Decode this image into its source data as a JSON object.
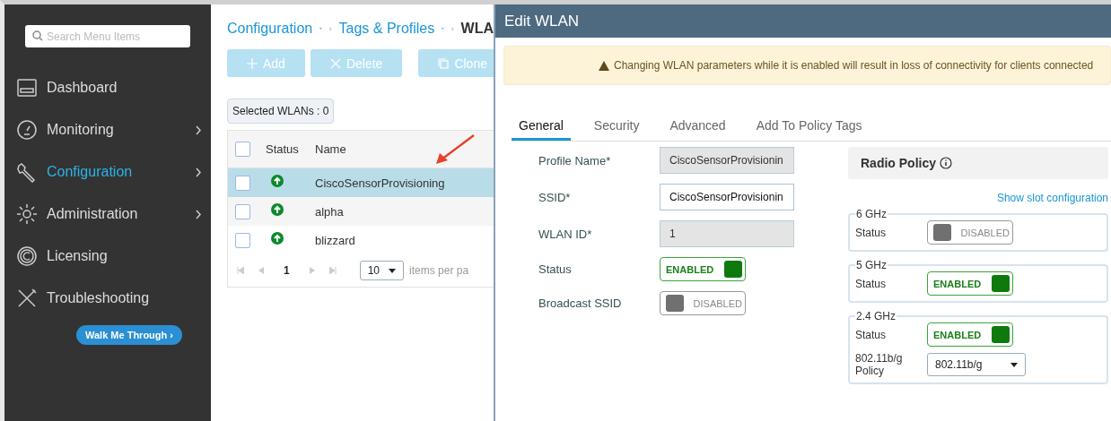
{
  "sidebar": {
    "search": {
      "placeholder": "Search Menu Items"
    },
    "items": [
      {
        "label": "Dashboard",
        "kind": "dashboard",
        "selected": false,
        "has_arrow": false
      },
      {
        "label": "Monitoring",
        "kind": "monitoring",
        "selected": false,
        "has_arrow": true
      },
      {
        "label": "Configuration",
        "kind": "configuration",
        "selected": true,
        "has_arrow": true
      },
      {
        "label": "Administration",
        "kind": "administration",
        "selected": false,
        "has_arrow": true
      },
      {
        "label": "Licensing",
        "kind": "licensing",
        "selected": false,
        "has_arrow": false
      },
      {
        "label": "Troubleshooting",
        "kind": "troubleshooting",
        "selected": false,
        "has_arrow": false
      }
    ],
    "walk_button": "Walk Me Through ›"
  },
  "breadcrumb": [
    {
      "label": "Configuration",
      "link": true
    },
    {
      "label": "Tags & Profiles",
      "link": true
    },
    {
      "label": "WLA",
      "link": false
    }
  ],
  "toolbar": [
    {
      "label": "Add",
      "kind": "add"
    },
    {
      "label": "Delete",
      "kind": "delete"
    },
    {
      "label": "Clone",
      "kind": "clone"
    }
  ],
  "selected_count": "Selected WLANs : 0",
  "table": {
    "columns": [
      "Status",
      "Name"
    ],
    "all_checked": false,
    "rows": [
      {
        "name": "CiscoSensorProvisioning",
        "selected": true,
        "checked": false
      },
      {
        "name": "alpha",
        "selected": false,
        "checked": false
      },
      {
        "name": "blizzard",
        "selected": false,
        "checked": false
      }
    ],
    "pagination": {
      "page": "1",
      "page_size": "10",
      "items_label": "items per pa"
    }
  },
  "edit_panel": {
    "title": "Edit WLAN",
    "warning": "Changing WLAN parameters while it is enabled will result in loss of connectivity for clients connected",
    "tabs": [
      {
        "label": "General",
        "selected": true
      },
      {
        "label": "Security",
        "selected": false
      },
      {
        "label": "Advanced",
        "selected": false
      },
      {
        "label": "Add To Policy Tags",
        "selected": false
      }
    ],
    "fields": [
      {
        "label": "Profile Name*",
        "kind": "text",
        "value": "CiscoSensorProvisionin",
        "disabled": true
      },
      {
        "label": "SSID*",
        "kind": "text",
        "value": "CiscoSensorProvisionin",
        "disabled": false
      },
      {
        "label": "WLAN ID*",
        "kind": "text",
        "value": "1",
        "disabled": true
      },
      {
        "label": "Status",
        "kind": "toggle",
        "on": true,
        "value": "ENABLED"
      },
      {
        "label": "Broadcast SSID",
        "kind": "toggle",
        "on": false,
        "value": "DISABLED"
      }
    ],
    "radio_policy": {
      "title": "Radio Policy",
      "link": "Show slot configuration",
      "bands": [
        {
          "legend": "6 GHz",
          "status_label": "Status",
          "on": false,
          "value": "DISABLED"
        },
        {
          "legend": "5 GHz",
          "status_label": "Status",
          "on": true,
          "value": "ENABLED"
        },
        {
          "legend": "2.4 GHz",
          "status_label": "Status",
          "on": true,
          "value": "ENABLED",
          "policy_label": "802.11b/g Policy",
          "policy_value": "802.11b/g"
        }
      ]
    }
  }
}
